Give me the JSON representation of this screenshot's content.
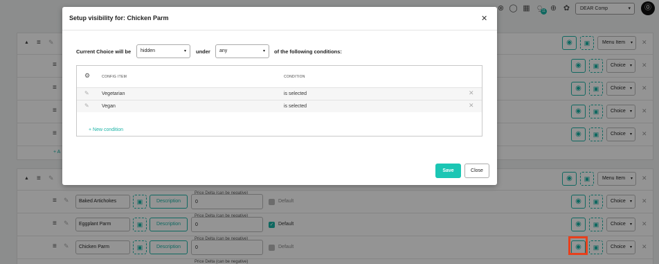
{
  "topbar": {
    "company": "DEAR Comp",
    "notification_count": "11",
    "avatar_initial": "⓪"
  },
  "background": {
    "menu_item_label": "Menu Item",
    "choice_label": "Choice",
    "add_label": "+ A",
    "price_delta_label": "Price Delta (can be negative)",
    "description_label": "Description",
    "default_label": "Default",
    "items": [
      {
        "name": "Baked Artichokes",
        "price": "0",
        "default": false
      },
      {
        "name": "Eggplant Parm",
        "price": "0",
        "default": true
      },
      {
        "name": "Chicken Parm",
        "price": "0",
        "default": false
      }
    ]
  },
  "modal": {
    "title": "Setup visibility for: Chicken Parm",
    "current_choice_label": "Current Choice will be",
    "visibility_value": "hidden",
    "under_label": "under",
    "match_value": "any",
    "conditions_suffix": "of the following conditions:",
    "table": {
      "col_item": "CONFIG ITEM",
      "col_condition": "CONDITION",
      "rows": [
        {
          "item": "Vegetarian",
          "condition": "is selected"
        },
        {
          "item": "Vegan",
          "condition": "is selected"
        }
      ],
      "new_condition": "+ New condition"
    },
    "save_label": "Save",
    "close_label": "Close"
  }
}
